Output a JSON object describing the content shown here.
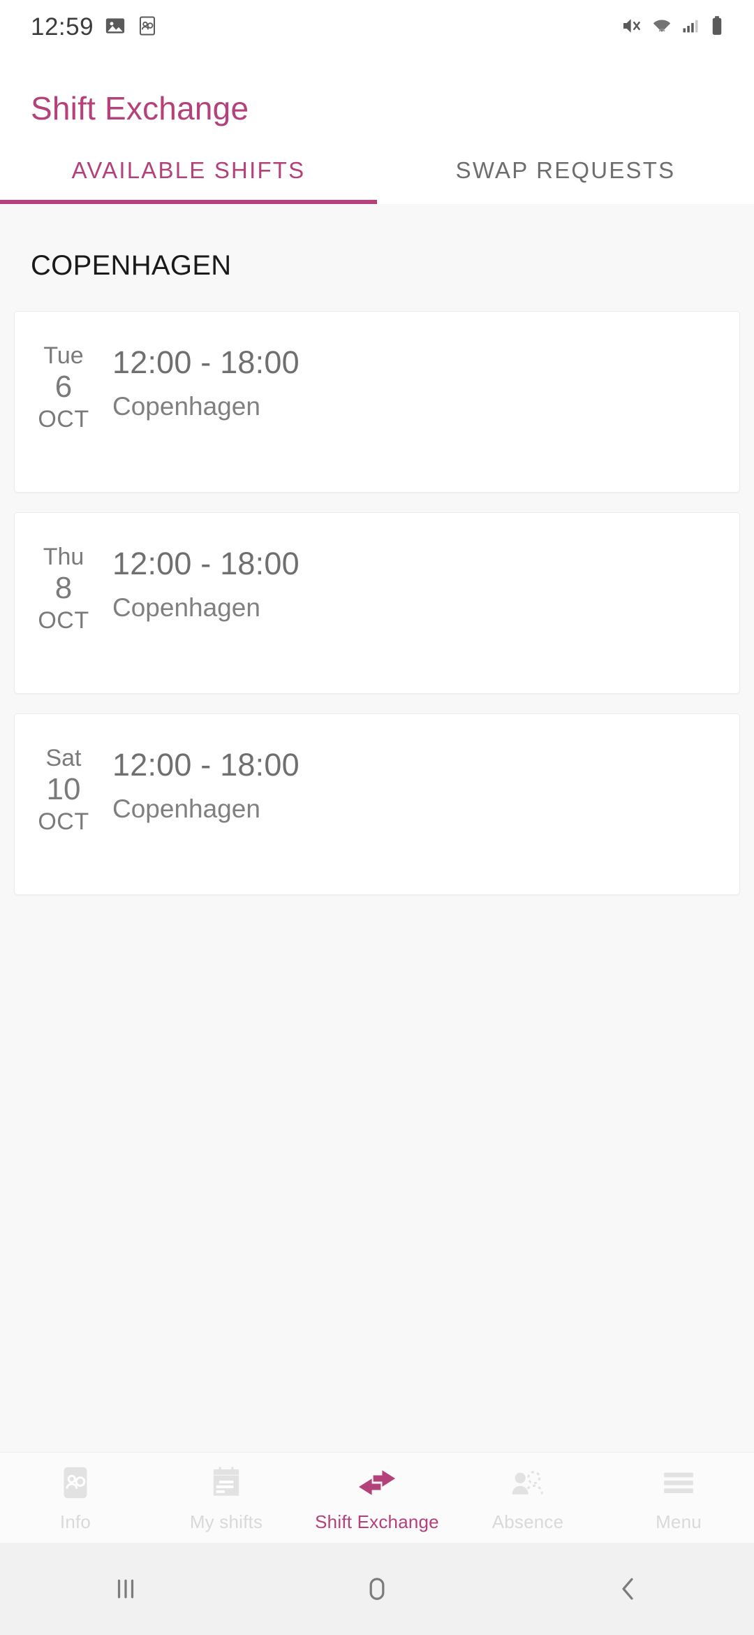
{
  "status_bar": {
    "time": "12:59",
    "left_icons": [
      "image-icon",
      "contacts-card-icon"
    ],
    "right_icons": [
      "mute-icon",
      "wifi-icon",
      "cellular-signal-icon",
      "battery-icon"
    ]
  },
  "app_bar": {
    "title": "Shift Exchange"
  },
  "tabs": [
    {
      "label": "AVAILABLE SHIFTS",
      "active": true
    },
    {
      "label": "SWAP REQUESTS",
      "active": false
    }
  ],
  "content": {
    "section_title": "COPENHAGEN",
    "shifts": [
      {
        "weekday": "Tue",
        "day": "6",
        "month": "OCT",
        "time": "12:00 - 18:00",
        "location": "Copenhagen"
      },
      {
        "weekday": "Thu",
        "day": "8",
        "month": "OCT",
        "time": "12:00 - 18:00",
        "location": "Copenhagen"
      },
      {
        "weekday": "Sat",
        "day": "10",
        "month": "OCT",
        "time": "12:00 - 18:00",
        "location": "Copenhagen"
      }
    ]
  },
  "bottom_nav": [
    {
      "label": "Info",
      "icon": "contacts-card-icon",
      "active": false
    },
    {
      "label": "My shifts",
      "icon": "calendar-doc-icon",
      "active": false
    },
    {
      "label": "Shift Exchange",
      "icon": "swap-arrows-icon",
      "active": true
    },
    {
      "label": "Absence",
      "icon": "person-absent-icon",
      "active": false
    },
    {
      "label": "Menu",
      "icon": "hamburger-menu-icon",
      "active": false
    }
  ],
  "system_nav": [
    {
      "name": "recents-button"
    },
    {
      "name": "home-button"
    },
    {
      "name": "back-button"
    }
  ],
  "colors": {
    "accent": "#b5417a",
    "page_bg": "#f8f8f8",
    "card_bg": "#ffffff",
    "muted_text": "#7a7a7a",
    "nav_inactive": "#d9d9d9"
  }
}
